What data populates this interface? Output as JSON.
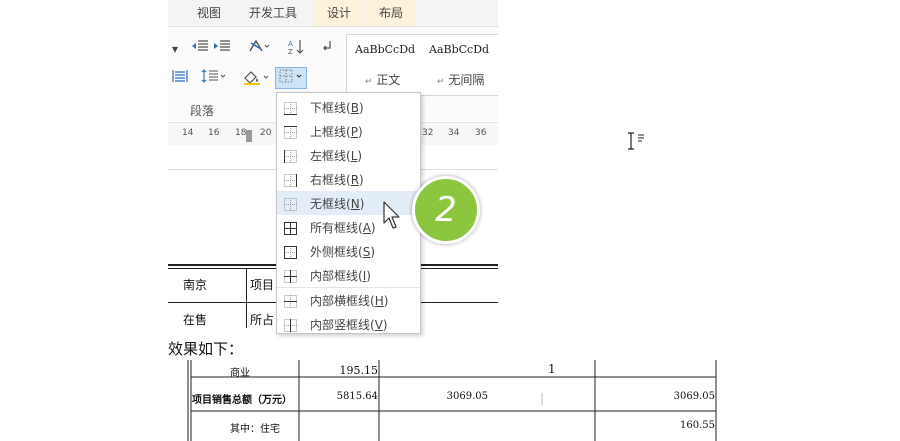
{
  "ribbon": {
    "tabs": [
      {
        "label": "视图"
      },
      {
        "label": "开发工具"
      },
      {
        "label": "设计"
      },
      {
        "label": "布局"
      }
    ],
    "group_label": "段落",
    "styles": [
      {
        "sample": "AaBbCcDd",
        "name": "正文"
      },
      {
        "sample": "AaBbCcDd",
        "name": "无间隔"
      }
    ],
    "ruler_ticks": [
      "14",
      "16",
      "18",
      "20",
      "32",
      "34",
      "36"
    ]
  },
  "document": {
    "cells": [
      "南京",
      "项目",
      "在售",
      "所占"
    ]
  },
  "border_menu": {
    "items": [
      {
        "label": "下框线",
        "key": "B",
        "icon": "border-bottom-icon"
      },
      {
        "label": "上框线",
        "key": "P",
        "icon": "border-top-icon"
      },
      {
        "label": "左框线",
        "key": "L",
        "icon": "border-left-icon"
      },
      {
        "label": "右框线",
        "key": "R",
        "icon": "border-right-icon"
      },
      {
        "label": "无框线",
        "key": "N",
        "icon": "border-none-icon"
      },
      {
        "label": "所有框线",
        "key": "A",
        "icon": "border-all-icon"
      },
      {
        "label": "外侧框线",
        "key": "S",
        "icon": "border-outside-icon"
      },
      {
        "label": "内部框线",
        "key": "I",
        "icon": "border-inside-icon"
      },
      {
        "label": "内部横框线",
        "key": "H",
        "icon": "border-inside-horizontal-icon"
      },
      {
        "label": "内部竖框线",
        "key": "V",
        "icon": "border-inside-vertical-icon"
      }
    ],
    "highlighted_index": 4
  },
  "step_badge": "2",
  "caption": "效果如下：",
  "result_table": {
    "rows": [
      [
        "商业",
        "195.15",
        "",
        "1",
        ""
      ],
      [
        "项目销售总额（万元）",
        "5815.64",
        "3069.05",
        "",
        "3069.05"
      ],
      [
        "其中：住宅",
        "",
        "",
        "",
        "160.55"
      ]
    ]
  },
  "colors": {
    "badge": "#8cc63f",
    "menu_highlight": "#e3edf7",
    "context_tab": "#fdf3dc",
    "selected_button": "#cde4f7"
  }
}
